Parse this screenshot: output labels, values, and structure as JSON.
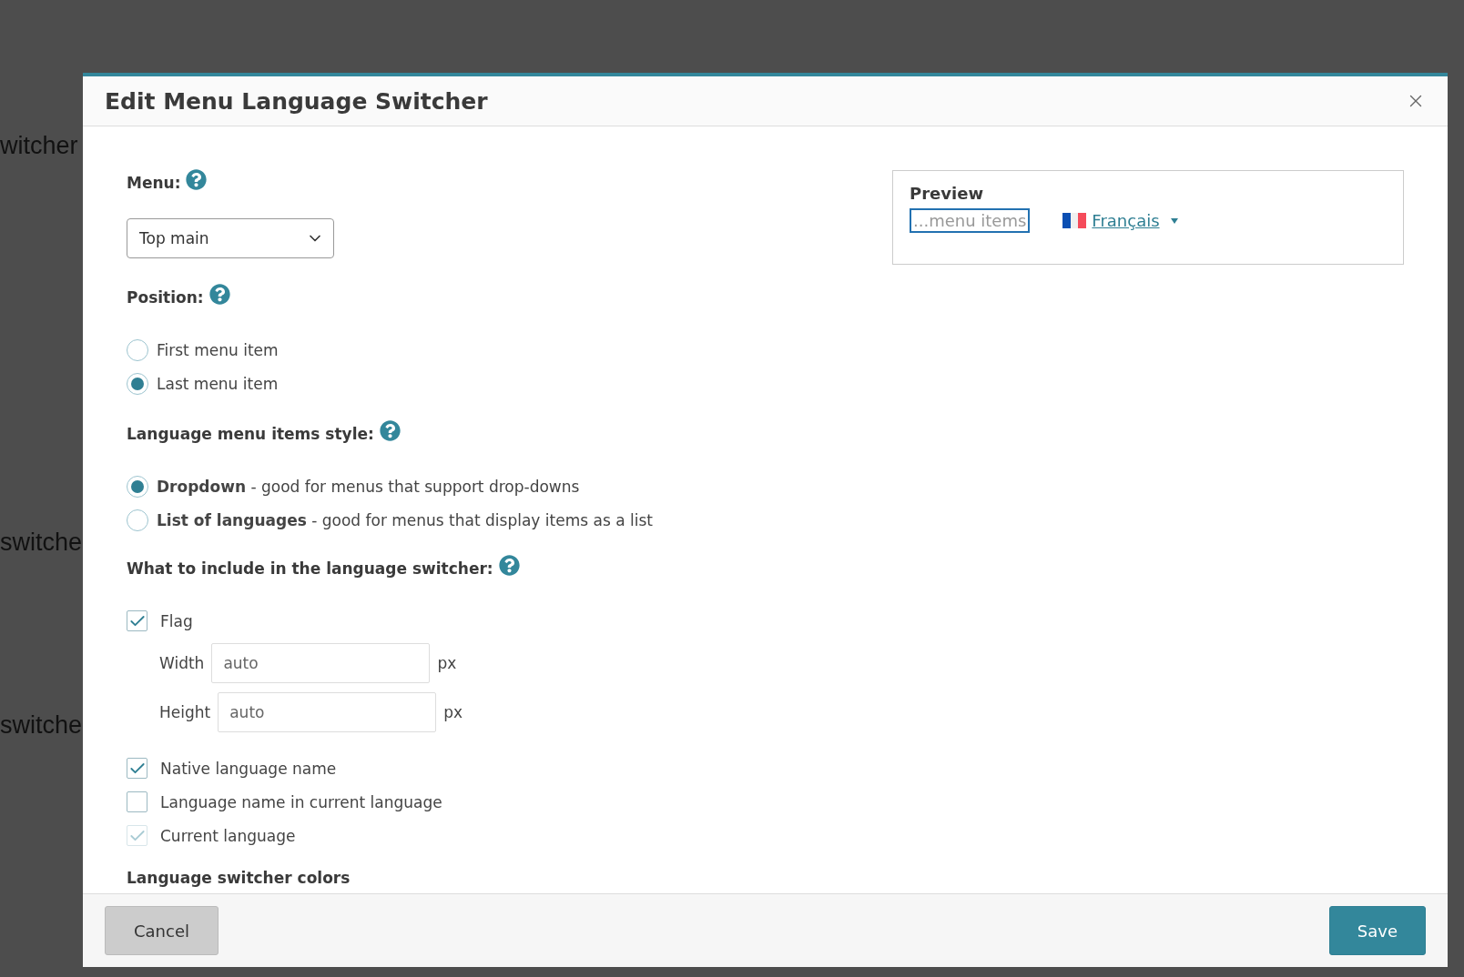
{
  "background": {
    "fragments": [
      "witcher",
      "switche",
      "switche"
    ]
  },
  "dialog": {
    "title": "Edit Menu Language Switcher"
  },
  "menu": {
    "label": "Menu:",
    "value": "Top main"
  },
  "position": {
    "label": "Position:",
    "options": [
      {
        "label": "First menu item",
        "selected": false
      },
      {
        "label": "Last menu item",
        "selected": true
      }
    ]
  },
  "style": {
    "label": "Language menu items style:",
    "options": [
      {
        "label": "**Dropdown** - good for menus that support drop-downs",
        "selected": true
      },
      {
        "label": "**List of languages** - good for menus that display items as a list",
        "selected": false
      }
    ]
  },
  "include": {
    "label": "What to include in the language switcher:",
    "items": [
      {
        "kind": "checkbox",
        "label": "Flag",
        "checked": true,
        "disabled": false
      },
      {
        "kind": "size",
        "label": "Width",
        "value": "auto",
        "unit": "px"
      },
      {
        "kind": "size",
        "label": "Height",
        "value": "auto",
        "unit": "px"
      },
      {
        "kind": "checkbox",
        "label": "Native language name",
        "checked": true,
        "disabled": false
      },
      {
        "kind": "checkbox",
        "label": "Language name in current language",
        "checked": false,
        "disabled": false
      },
      {
        "kind": "checkbox",
        "label": "Current language",
        "checked": true,
        "disabled": true
      }
    ]
  },
  "colors_heading": "Language switcher colors",
  "preview": {
    "title": "Preview",
    "menu_items": "...menu items",
    "language": "Français"
  },
  "footer": {
    "cancel": "Cancel",
    "save": "Save"
  }
}
